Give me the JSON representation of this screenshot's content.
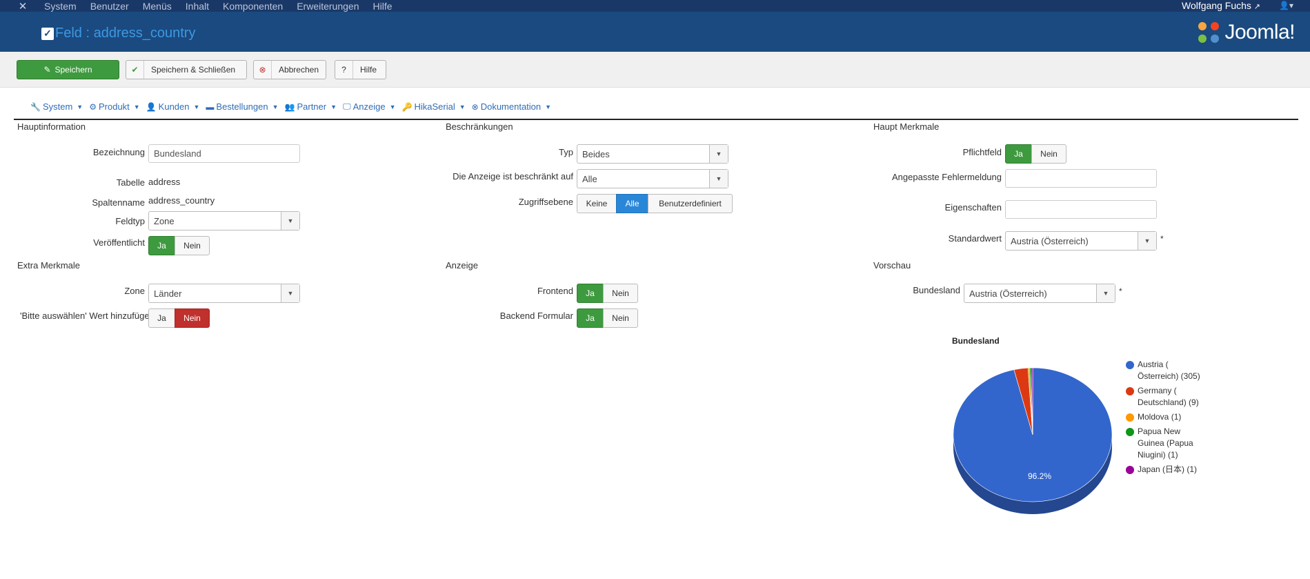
{
  "topbar": {
    "menu": [
      "System",
      "Benutzer",
      "Menüs",
      "Inhalt",
      "Komponenten",
      "Erweiterungen",
      "Hilfe"
    ],
    "user": "Wolfgang Fuchs"
  },
  "header": {
    "title": "Feld : address_country",
    "brand": "Joomla!"
  },
  "toolbar": {
    "save": "Speichern",
    "save_close": "Speichern & Schließen",
    "cancel": "Abbrechen",
    "help": "Hilfe"
  },
  "subnav": [
    {
      "label": "System",
      "icon": "wrench-icon"
    },
    {
      "label": "Produkt",
      "icon": "cubes-icon"
    },
    {
      "label": "Kunden",
      "icon": "user-icon"
    },
    {
      "label": "Bestellungen",
      "icon": "credit-card-icon"
    },
    {
      "label": "Partner",
      "icon": "users-icon"
    },
    {
      "label": "Anzeige",
      "icon": "monitor-icon"
    },
    {
      "label": "HikaSerial",
      "icon": "key-icon"
    },
    {
      "label": "Dokumentation",
      "icon": "help-circle-icon"
    }
  ],
  "main_info": {
    "title": "Hauptinformation",
    "label_name": "Bezeichnung",
    "name_value": "Bundesland",
    "label_table": "Tabelle",
    "table_value": "address",
    "label_column": "Spaltenname",
    "column_value": "address_country",
    "label_fieldtype": "Feldtyp",
    "fieldtype_value": "Zone",
    "label_published": "Veröffentlicht",
    "yes": "Ja",
    "no": "Nein"
  },
  "restrictions": {
    "title": "Beschränkungen",
    "label_type": "Typ",
    "type_value": "Beides",
    "label_display_limit": "Die Anzeige ist beschränkt auf",
    "display_limit_value": "Alle",
    "label_access": "Zugriffsebene",
    "access_none": "Keine",
    "access_all": "Alle",
    "access_custom": "Benutzerdefiniert"
  },
  "main_features": {
    "title": "Haupt Merkmale",
    "label_required": "Pflichtfeld",
    "label_error": "Angepasste Fehlermeldung",
    "label_properties": "Eigenschaften",
    "label_default": "Standardwert",
    "default_value": "Austria (Österreich)",
    "star": "*"
  },
  "extra_features": {
    "title": "Extra Merkmale",
    "label_zone": "Zone",
    "zone_value": "Länder",
    "label_please_select": "'Bitte auswählen' Wert hinzufüge"
  },
  "display": {
    "title": "Anzeige",
    "label_frontend": "Frontend",
    "label_backend": "Backend Formular"
  },
  "preview": {
    "title": "Vorschau",
    "label": "Bundesland",
    "value": "Austria (Österreich)"
  },
  "chart_data": {
    "type": "pie",
    "title": "Bundesland",
    "series": [
      {
        "label": "Austria ( Österreich) (305)",
        "value": 305,
        "color": "#3366cc"
      },
      {
        "label": "Germany ( Deutschland) (9)",
        "value": 9,
        "color": "#dc3912"
      },
      {
        "label": "Moldova (1)",
        "value": 1,
        "color": "#ff9900"
      },
      {
        "label": "Papua New Guinea (Papua Niugini) (1)",
        "value": 1,
        "color": "#109618"
      },
      {
        "label": "Japan (日本) (1)",
        "value": 1,
        "color": "#990099"
      }
    ],
    "slice_label": "96.2%",
    "legend_position": "right"
  }
}
